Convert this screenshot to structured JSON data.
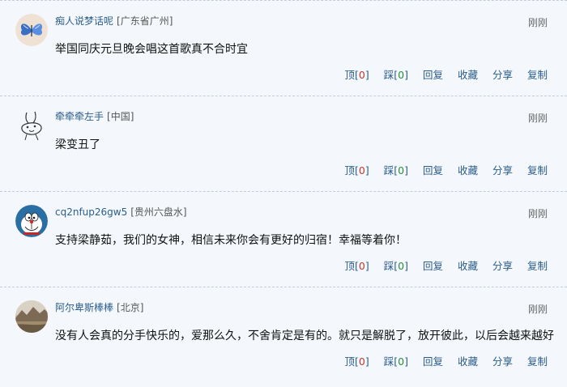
{
  "actions": {
    "up": "顶",
    "down": "踩",
    "reply": "回复",
    "favorite": "收藏",
    "share": "分享",
    "copy": "复制",
    "open_bracket": "[",
    "close_bracket": "]"
  },
  "comments": [
    {
      "username": "痴人说梦话呢",
      "location": "[广东省广州]",
      "time": "刚刚",
      "text": "举国同庆元旦晚会唱这首歌真不合时宜",
      "up_count": "0",
      "down_count": "0",
      "avatar_icon": "butterfly-icon"
    },
    {
      "username": "牵牵牵左手",
      "location": "[中国]",
      "time": "刚刚",
      "text": "梁变丑了",
      "up_count": "0",
      "down_count": "0",
      "avatar_icon": "bunny-sketch-icon"
    },
    {
      "username": "cq2nfup26gw5",
      "location": "[贵州六盘水]",
      "time": "刚刚",
      "text": "支持梁静茹，我们的女神，相信未来你会有更好的归宿！幸福等着你！",
      "up_count": "0",
      "down_count": "0",
      "avatar_icon": "doraemon-icon"
    },
    {
      "username": "阿尔卑斯棒棒",
      "location": "[北京]",
      "time": "刚刚",
      "text": "没有人会真的分手快乐的，爱那么久，不舍肯定是有的。就只是解脱了，放开彼此，以后会越来越好",
      "up_count": "0",
      "down_count": "0",
      "avatar_icon": "mountain-landscape-icon"
    }
  ]
}
